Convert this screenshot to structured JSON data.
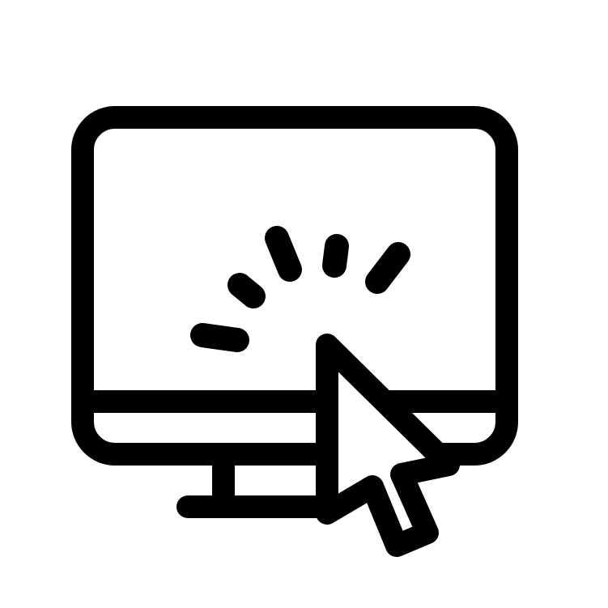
{
  "icon": {
    "name": "monitor-click-icon",
    "parts": [
      "monitor-icon",
      "cursor-arrow-icon",
      "click-burst-icon"
    ]
  },
  "colors": {
    "stroke": "#000000",
    "background": "#ffffff"
  }
}
